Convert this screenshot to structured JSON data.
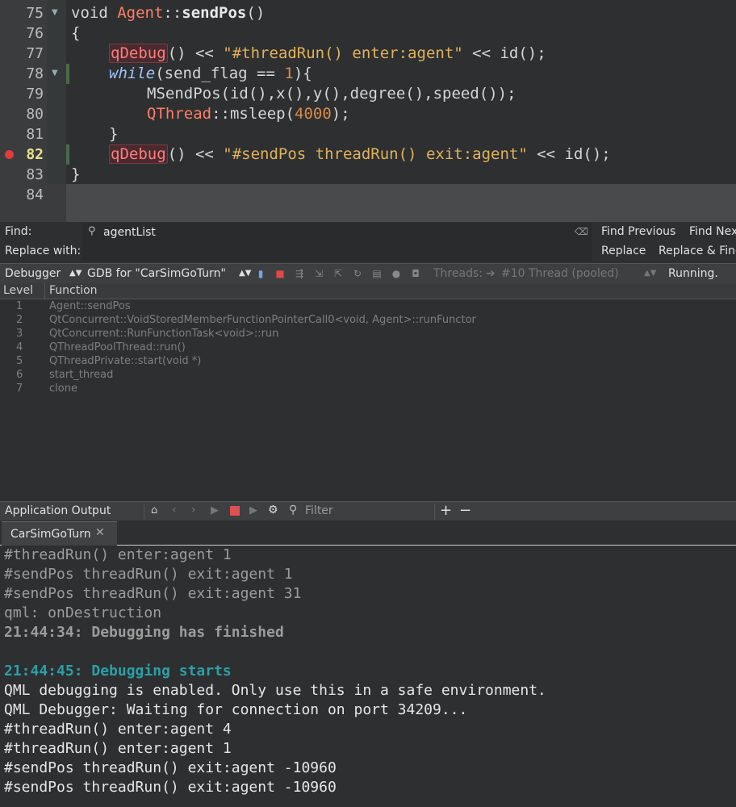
{
  "editor": {
    "lines": [
      {
        "num": "75"
      },
      {
        "num": "76"
      },
      {
        "num": "77"
      },
      {
        "num": "78"
      },
      {
        "num": "79"
      },
      {
        "num": "80"
      },
      {
        "num": "81"
      },
      {
        "num": "82"
      },
      {
        "num": "83"
      },
      {
        "num": "84"
      }
    ],
    "code": {
      "l75_void": "void ",
      "l75_class": "Agent",
      "l75_sep": "::",
      "l75_fn": "sendPos",
      "l75_paren": "()",
      "l76": "{",
      "l77_call": "qDebug",
      "l77_rest1": "() << ",
      "l77_str": "\"#threadRun() enter:agent\"",
      "l77_rest2": " << id();",
      "l78_kw": "while",
      "l78_rest1": "(send_flag == ",
      "l78_num": "1",
      "l78_rest2": "){",
      "l79": "MSendPos(id(),x(),y(),degree(),speed());",
      "l80_class": "QThread",
      "l80_rest1": "::msleep(",
      "l80_num": "4000",
      "l80_rest2": ");",
      "l81": "}",
      "l82_call": "qDebug",
      "l82_rest1": "() << ",
      "l82_str": "\"#sendPos threadRun() exit:agent\"",
      "l82_rest2": " << id();",
      "l83": "}"
    }
  },
  "find": {
    "find_label": "Find:",
    "replace_label": "Replace with:",
    "find_value": "agentList",
    "find_prev": "Find Previous",
    "find_next": "Find Nex",
    "replace": "Replace",
    "replace_find": "Replace & Find"
  },
  "debugger": {
    "perspective": "Debugger",
    "engine": "GDB for \"CarSimGoTurn\"",
    "threads_label": "Threads:",
    "thread_value": "#10 Thread (pooled)",
    "status": "Running."
  },
  "stack": {
    "col_level": "Level",
    "col_function": "Function",
    "rows": [
      {
        "level": "1",
        "function": "Agent::sendPos"
      },
      {
        "level": "2",
        "function": "QtConcurrent::VoidStoredMemberFunctionPointerCall0<void, Agent>::runFunctor"
      },
      {
        "level": "3",
        "function": "QtConcurrent::RunFunctionTask<void>::run"
      },
      {
        "level": "4",
        "function": "QThreadPoolThread::run()"
      },
      {
        "level": "5",
        "function": "QThreadPrivate::start(void *)"
      },
      {
        "level": "6",
        "function": "start_thread"
      },
      {
        "level": "7",
        "function": "clone"
      }
    ]
  },
  "output": {
    "pane_title": "Application Output",
    "filter_placeholder": "Filter",
    "tab_label": "CarSimGoTurn",
    "lines": [
      {
        "text": "#threadRun() enter:agent 1"
      },
      {
        "text": "#sendPos threadRun() exit:agent 1"
      },
      {
        "text": "#sendPos threadRun() exit:agent 31"
      },
      {
        "text": "qml: onDestruction"
      },
      {
        "text": "21:44:34: Debugging has finished"
      },
      {
        "text": ""
      },
      {
        "text": "21:44:45: Debugging starts"
      },
      {
        "text": "QML debugging is enabled. Only use this in a safe environment."
      },
      {
        "text": "QML Debugger: Waiting for connection on port 34209..."
      },
      {
        "text": "#threadRun() enter:agent 4"
      },
      {
        "text": "#threadRun() enter:agent 1"
      },
      {
        "text": "#sendPos threadRun() exit:agent -10960"
      },
      {
        "text": "#sendPos threadRun() exit:agent -10960"
      }
    ]
  },
  "colors": {
    "breakpoint": "#e03c3c",
    "debug_starts": "#2aa0a8"
  }
}
